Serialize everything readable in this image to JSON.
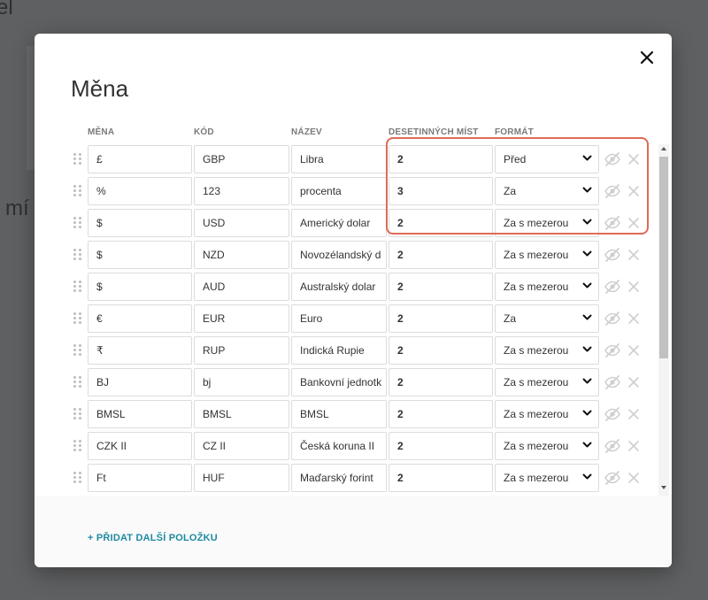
{
  "background": {
    "text_top": "el",
    "text_mid": "mí"
  },
  "modal": {
    "title": "Měna",
    "columns": {
      "mena": "MĚNA",
      "kod": "KÓD",
      "nazev": "NÁZEV",
      "desetinnych_mist": "DESETINNÝCH MÍST",
      "format": "FORMÁT"
    },
    "rows": [
      {
        "mena": "£",
        "kod": "GBP",
        "nazev": "Libra",
        "desetinnych_mist": "2",
        "format": "Před"
      },
      {
        "mena": "%",
        "kod": "123",
        "nazev": "procenta",
        "desetinnych_mist": "3",
        "format": "Za"
      },
      {
        "mena": "$",
        "kod": "USD",
        "nazev": "Americký dolar",
        "desetinnych_mist": "2",
        "format": "Za s mezerou"
      },
      {
        "mena": "$",
        "kod": "NZD",
        "nazev": "Novozélandský d",
        "desetinnych_mist": "2",
        "format": "Za s mezerou"
      },
      {
        "mena": "$",
        "kod": "AUD",
        "nazev": "Australský dolar",
        "desetinnych_mist": "2",
        "format": "Za s mezerou"
      },
      {
        "mena": "€",
        "kod": "EUR",
        "nazev": "Euro",
        "desetinnych_mist": "2",
        "format": "Za"
      },
      {
        "mena": "₹",
        "kod": "RUP",
        "nazev": "Indická Rupie",
        "desetinnych_mist": "2",
        "format": "Za s mezerou"
      },
      {
        "mena": "BJ",
        "kod": "bj",
        "nazev": "Bankovní jednotk",
        "desetinnych_mist": "2",
        "format": "Za s mezerou"
      },
      {
        "mena": "BMSL",
        "kod": "BMSL",
        "nazev": "BMSL",
        "desetinnych_mist": "2",
        "format": "Za s mezerou"
      },
      {
        "mena": "CZK II",
        "kod": "CZ II",
        "nazev": "Česká koruna II",
        "desetinnych_mist": "2",
        "format": "Za s mezerou"
      },
      {
        "mena": "Ft",
        "kod": "HUF",
        "nazev": "Maďarský forint",
        "desetinnych_mist": "2",
        "format": "Za s mezerou"
      },
      {
        "mena": "",
        "kod": "",
        "nazev": "",
        "desetinnych_mist": "",
        "format": ""
      }
    ],
    "add_item_label": "+ PŘIDAT DALŠÍ POLOŽKU"
  },
  "icons": {
    "close": "close-icon",
    "drag": "drag-handle-icon",
    "visibility": "eye-off-icon",
    "remove": "delete-x-icon",
    "dropdown": "chevron-down-icon"
  },
  "colors": {
    "highlight": "#e06a57",
    "accent": "#1e8aa0",
    "overlay": "#5f6061"
  }
}
